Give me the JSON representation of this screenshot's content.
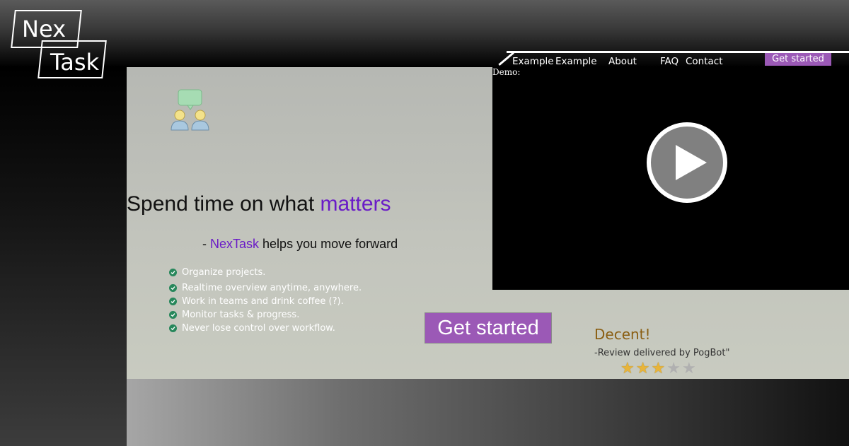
{
  "brand": {
    "logo_top": "Nex",
    "logo_bottom": "Task"
  },
  "nav": {
    "items": [
      "Example",
      "Example",
      "About",
      "FAQ",
      "Contact"
    ],
    "cta": "Get started"
  },
  "hero": {
    "headline_prefix": "Spend time on what ",
    "headline_accent": "matters",
    "sub_prefix": "- ",
    "sub_accent": "NexTask",
    "sub_suffix": " helps you move forward",
    "features": [
      "Organize projects.",
      "Realtime overview anytime, anywhere.",
      "Work in teams and drink coffee (?).",
      "Monitor tasks & progress.",
      "Never lose control over workflow."
    ],
    "cta": "Get started"
  },
  "video": {
    "label": "Demo:"
  },
  "review": {
    "title": "Decent!",
    "by": "-Review delivered by PogBot\"",
    "rating": 3,
    "max": 5
  },
  "colors": {
    "accent": "#6a1bc7",
    "button": "#9b59b6",
    "check": "#27875b",
    "review_title": "#8a5e12",
    "star": "#e8b43a"
  },
  "icons": {
    "team": "team-chat-icon",
    "play": "play-icon",
    "check": "check-circle-icon",
    "star": "star-icon"
  }
}
